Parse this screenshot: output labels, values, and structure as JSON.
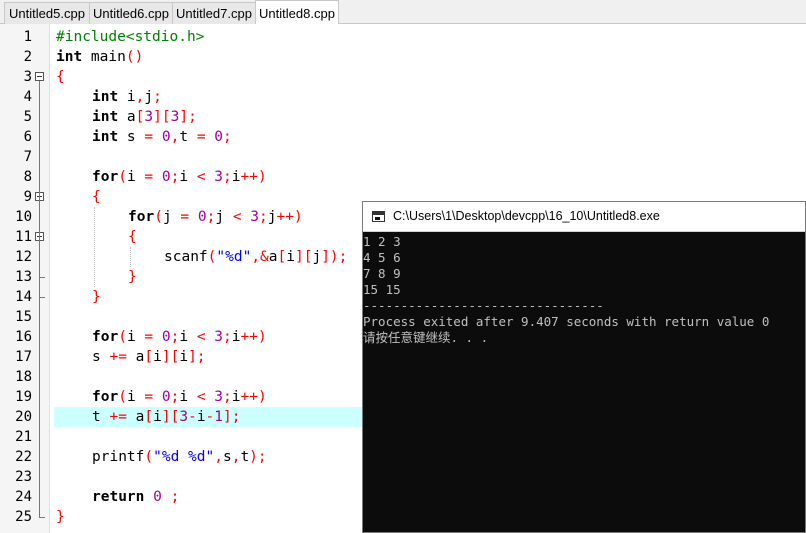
{
  "tabs": [
    {
      "label": "Untitled5.cpp",
      "active": false
    },
    {
      "label": "Untitled6.cpp",
      "active": false
    },
    {
      "label": "Untitled7.cpp",
      "active": false
    },
    {
      "label": "Untitled8.cpp",
      "active": true
    }
  ],
  "editor": {
    "highlighted_line": 20,
    "lines": [
      {
        "n": "1",
        "indent": 0,
        "tokens": [
          {
            "t": "#include<stdio.h>",
            "c": "pp"
          }
        ]
      },
      {
        "n": "2",
        "indent": 0,
        "tokens": [
          {
            "t": "int",
            "c": "kw"
          },
          {
            "t": " main",
            "c": ""
          },
          {
            "t": "()",
            "c": "sym"
          }
        ]
      },
      {
        "n": "3",
        "indent": 0,
        "tokens": [
          {
            "t": "{",
            "c": "sym"
          }
        ]
      },
      {
        "n": "4",
        "indent": 1,
        "tokens": [
          {
            "t": "int",
            "c": "kw"
          },
          {
            "t": " i",
            "c": ""
          },
          {
            "t": ",",
            "c": "sym"
          },
          {
            "t": "j",
            "c": ""
          },
          {
            "t": ";",
            "c": "sym"
          }
        ]
      },
      {
        "n": "5",
        "indent": 1,
        "tokens": [
          {
            "t": "int",
            "c": "kw"
          },
          {
            "t": " a",
            "c": ""
          },
          {
            "t": "[",
            "c": "sym"
          },
          {
            "t": "3",
            "c": "num"
          },
          {
            "t": "][",
            "c": "sym"
          },
          {
            "t": "3",
            "c": "num"
          },
          {
            "t": "];",
            "c": "sym"
          }
        ]
      },
      {
        "n": "6",
        "indent": 1,
        "tokens": [
          {
            "t": "int",
            "c": "kw"
          },
          {
            "t": " s ",
            "c": ""
          },
          {
            "t": "=",
            "c": "sym"
          },
          {
            "t": " ",
            "c": ""
          },
          {
            "t": "0",
            "c": "num"
          },
          {
            "t": ",",
            "c": "sym"
          },
          {
            "t": "t ",
            "c": ""
          },
          {
            "t": "=",
            "c": "sym"
          },
          {
            "t": " ",
            "c": ""
          },
          {
            "t": "0",
            "c": "num"
          },
          {
            "t": ";",
            "c": "sym"
          }
        ]
      },
      {
        "n": "7",
        "indent": 0,
        "tokens": []
      },
      {
        "n": "8",
        "indent": 1,
        "tokens": [
          {
            "t": "for",
            "c": "kw"
          },
          {
            "t": "(",
            "c": "sym"
          },
          {
            "t": "i ",
            "c": ""
          },
          {
            "t": "=",
            "c": "sym"
          },
          {
            "t": " ",
            "c": ""
          },
          {
            "t": "0",
            "c": "num"
          },
          {
            "t": ";",
            "c": "sym"
          },
          {
            "t": "i ",
            "c": ""
          },
          {
            "t": "<",
            "c": "sym"
          },
          {
            "t": " ",
            "c": ""
          },
          {
            "t": "3",
            "c": "num"
          },
          {
            "t": ";",
            "c": "sym"
          },
          {
            "t": "i",
            "c": ""
          },
          {
            "t": "++)",
            "c": "sym"
          }
        ]
      },
      {
        "n": "9",
        "indent": 1,
        "tokens": [
          {
            "t": "{",
            "c": "sym"
          }
        ]
      },
      {
        "n": "10",
        "indent": 2,
        "tokens": [
          {
            "t": "for",
            "c": "kw"
          },
          {
            "t": "(",
            "c": "sym"
          },
          {
            "t": "j ",
            "c": ""
          },
          {
            "t": "=",
            "c": "sym"
          },
          {
            "t": " ",
            "c": ""
          },
          {
            "t": "0",
            "c": "num"
          },
          {
            "t": ";",
            "c": "sym"
          },
          {
            "t": "j ",
            "c": ""
          },
          {
            "t": "<",
            "c": "sym"
          },
          {
            "t": " ",
            "c": ""
          },
          {
            "t": "3",
            "c": "num"
          },
          {
            "t": ";",
            "c": "sym"
          },
          {
            "t": "j",
            "c": ""
          },
          {
            "t": "++)",
            "c": "sym"
          }
        ]
      },
      {
        "n": "11",
        "indent": 2,
        "tokens": [
          {
            "t": "{",
            "c": "sym"
          }
        ]
      },
      {
        "n": "12",
        "indent": 3,
        "tokens": [
          {
            "t": "scanf",
            "c": ""
          },
          {
            "t": "(",
            "c": "sym"
          },
          {
            "t": "\"%d\"",
            "c": "str"
          },
          {
            "t": ",&",
            "c": "sym"
          },
          {
            "t": "a",
            "c": ""
          },
          {
            "t": "[",
            "c": "sym"
          },
          {
            "t": "i",
            "c": ""
          },
          {
            "t": "][",
            "c": "sym"
          },
          {
            "t": "j",
            "c": ""
          },
          {
            "t": "]);",
            "c": "sym"
          }
        ]
      },
      {
        "n": "13",
        "indent": 2,
        "tokens": [
          {
            "t": "}",
            "c": "sym"
          }
        ]
      },
      {
        "n": "14",
        "indent": 1,
        "tokens": [
          {
            "t": "}",
            "c": "sym"
          }
        ]
      },
      {
        "n": "15",
        "indent": 0,
        "tokens": []
      },
      {
        "n": "16",
        "indent": 1,
        "tokens": [
          {
            "t": "for",
            "c": "kw"
          },
          {
            "t": "(",
            "c": "sym"
          },
          {
            "t": "i ",
            "c": ""
          },
          {
            "t": "=",
            "c": "sym"
          },
          {
            "t": " ",
            "c": ""
          },
          {
            "t": "0",
            "c": "num"
          },
          {
            "t": ";",
            "c": "sym"
          },
          {
            "t": "i ",
            "c": ""
          },
          {
            "t": "<",
            "c": "sym"
          },
          {
            "t": " ",
            "c": ""
          },
          {
            "t": "3",
            "c": "num"
          },
          {
            "t": ";",
            "c": "sym"
          },
          {
            "t": "i",
            "c": ""
          },
          {
            "t": "++)",
            "c": "sym"
          }
        ]
      },
      {
        "n": "17",
        "indent": 1,
        "tokens": [
          {
            "t": "s ",
            "c": ""
          },
          {
            "t": "+=",
            "c": "sym"
          },
          {
            "t": " a",
            "c": ""
          },
          {
            "t": "[",
            "c": "sym"
          },
          {
            "t": "i",
            "c": ""
          },
          {
            "t": "][",
            "c": "sym"
          },
          {
            "t": "i",
            "c": ""
          },
          {
            "t": "];",
            "c": "sym"
          }
        ]
      },
      {
        "n": "18",
        "indent": 0,
        "tokens": []
      },
      {
        "n": "19",
        "indent": 1,
        "tokens": [
          {
            "t": "for",
            "c": "kw"
          },
          {
            "t": "(",
            "c": "sym"
          },
          {
            "t": "i ",
            "c": ""
          },
          {
            "t": "=",
            "c": "sym"
          },
          {
            "t": " ",
            "c": ""
          },
          {
            "t": "0",
            "c": "num"
          },
          {
            "t": ";",
            "c": "sym"
          },
          {
            "t": "i ",
            "c": ""
          },
          {
            "t": "<",
            "c": "sym"
          },
          {
            "t": " ",
            "c": ""
          },
          {
            "t": "3",
            "c": "num"
          },
          {
            "t": ";",
            "c": "sym"
          },
          {
            "t": "i",
            "c": ""
          },
          {
            "t": "++)",
            "c": "sym"
          }
        ]
      },
      {
        "n": "20",
        "indent": 1,
        "tokens": [
          {
            "t": "t ",
            "c": ""
          },
          {
            "t": "+=",
            "c": "sym"
          },
          {
            "t": " a",
            "c": ""
          },
          {
            "t": "[",
            "c": "sym"
          },
          {
            "t": "i",
            "c": ""
          },
          {
            "t": "][",
            "c": "sym"
          },
          {
            "t": "3",
            "c": "num"
          },
          {
            "t": "-",
            "c": "sym"
          },
          {
            "t": "i",
            "c": ""
          },
          {
            "t": "-",
            "c": "sym"
          },
          {
            "t": "1",
            "c": "num"
          },
          {
            "t": "];",
            "c": "sym"
          }
        ]
      },
      {
        "n": "21",
        "indent": 0,
        "tokens": []
      },
      {
        "n": "22",
        "indent": 1,
        "tokens": [
          {
            "t": "printf",
            "c": ""
          },
          {
            "t": "(",
            "c": "sym"
          },
          {
            "t": "\"%d %d\"",
            "c": "str"
          },
          {
            "t": ",",
            "c": "sym"
          },
          {
            "t": "s",
            "c": ""
          },
          {
            "t": ",",
            "c": "sym"
          },
          {
            "t": "t",
            "c": ""
          },
          {
            "t": ");",
            "c": "sym"
          }
        ]
      },
      {
        "n": "23",
        "indent": 0,
        "tokens": []
      },
      {
        "n": "24",
        "indent": 1,
        "tokens": [
          {
            "t": "return",
            "c": "kw"
          },
          {
            "t": " ",
            "c": ""
          },
          {
            "t": "0",
            "c": "num"
          },
          {
            "t": " ",
            "c": ""
          },
          {
            "t": ";",
            "c": "sym"
          }
        ]
      },
      {
        "n": "25",
        "indent": 0,
        "tokens": [
          {
            "t": "}",
            "c": "sym"
          }
        ]
      }
    ]
  },
  "console": {
    "title": "C:\\Users\\1\\Desktop\\devcpp\\16_10\\Untitled8.exe",
    "lines": [
      "1 2 3",
      "4 5 6",
      "7 8 9",
      "15 15",
      "--------------------------------",
      "Process exited after 9.407 seconds with return value 0",
      "请按任意键继续. . ."
    ]
  }
}
